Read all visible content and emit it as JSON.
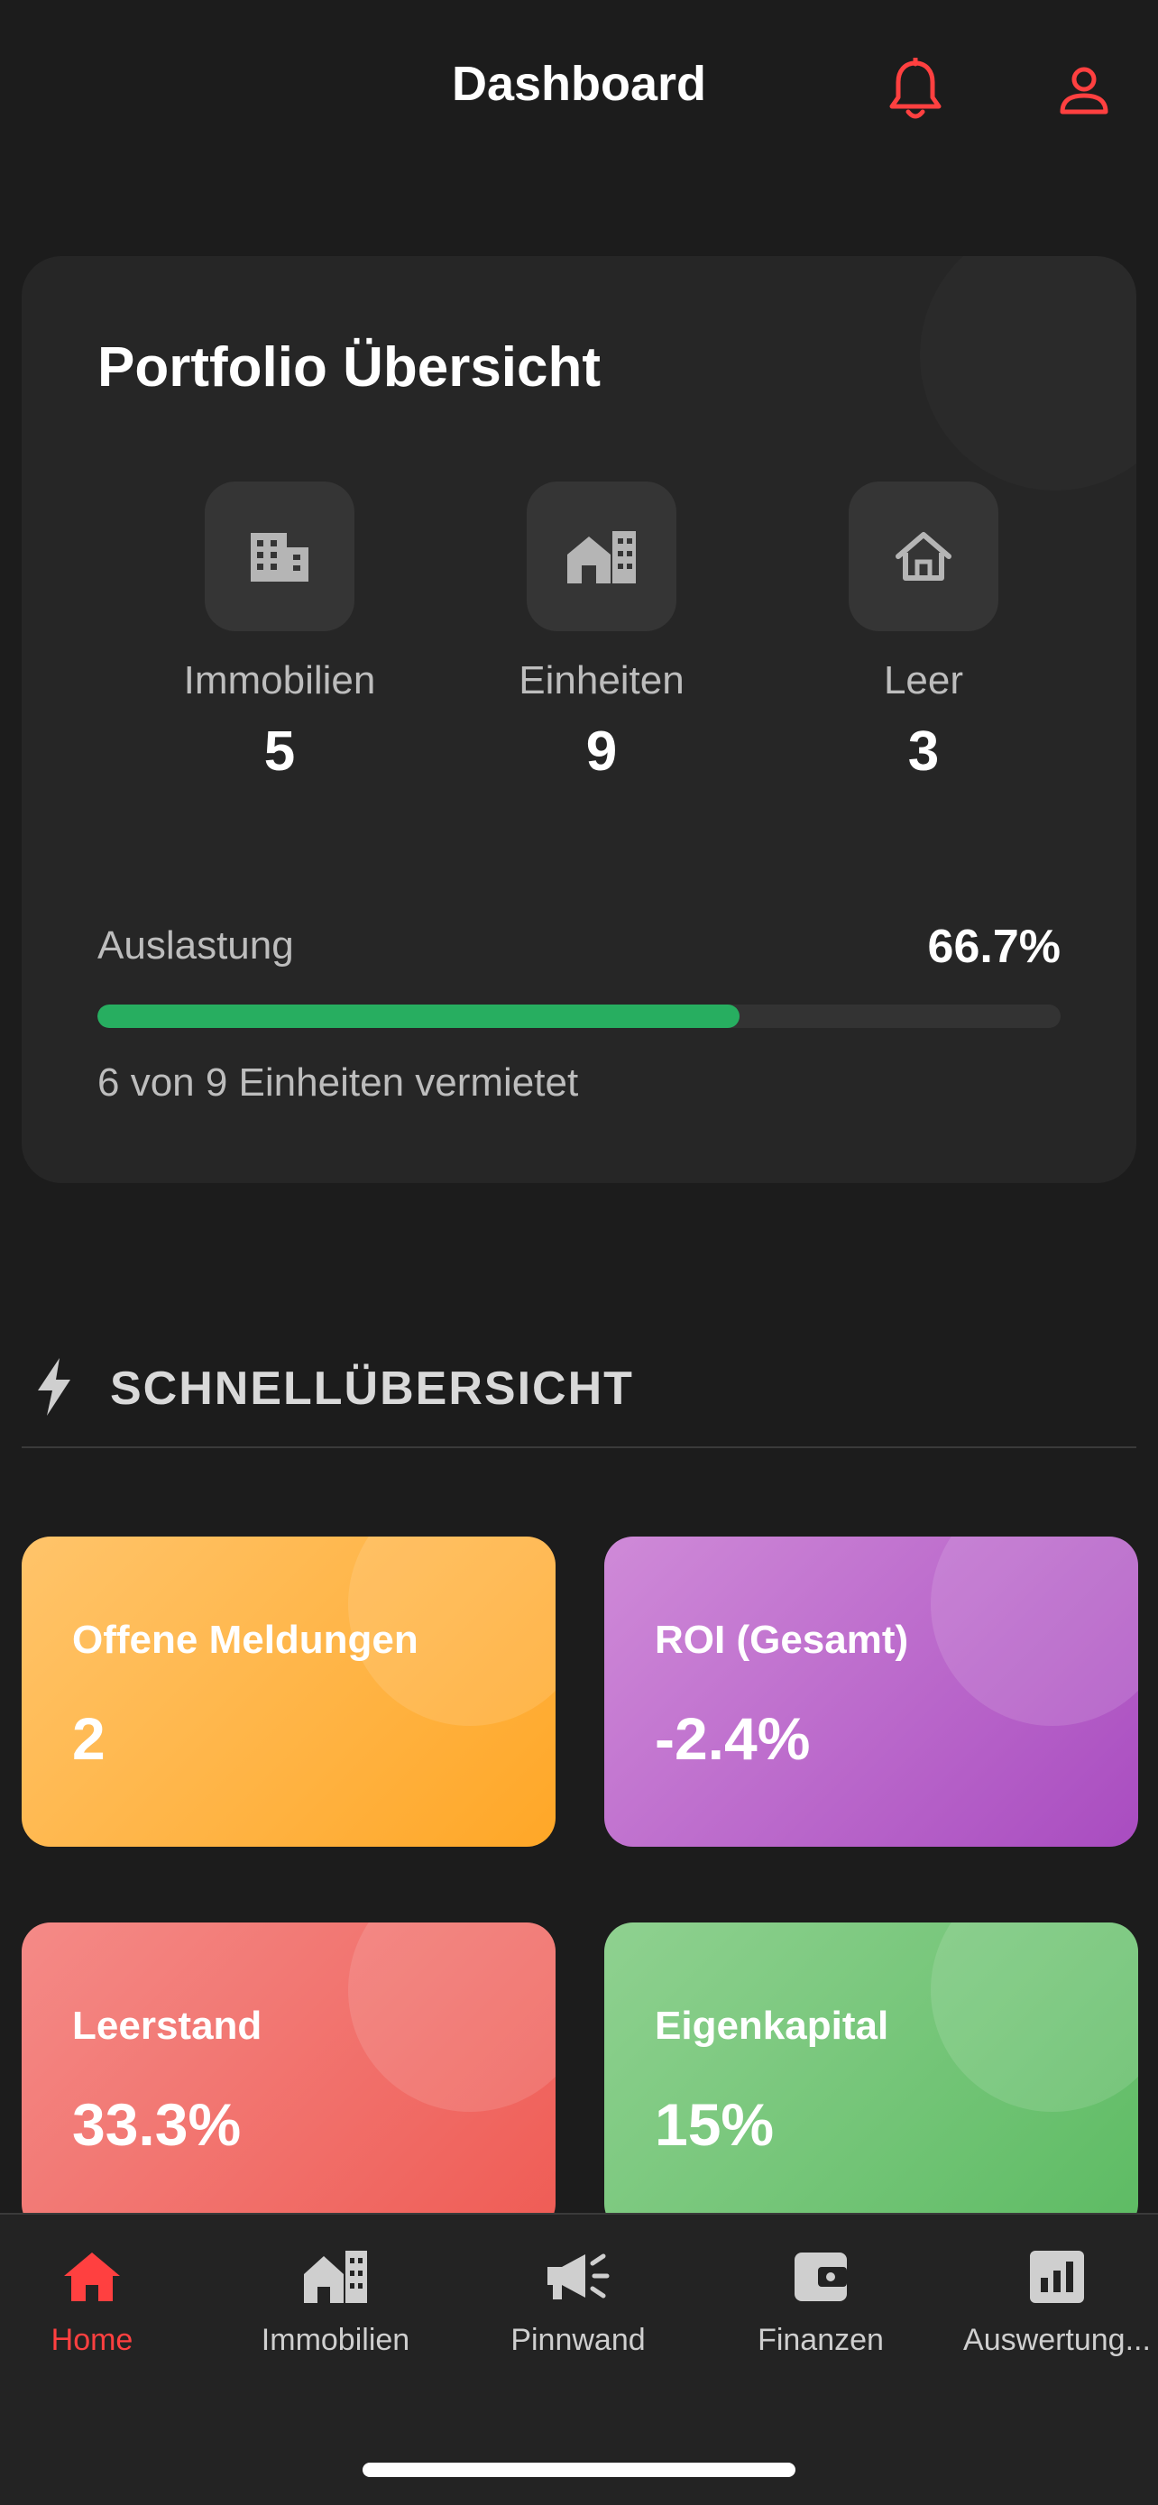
{
  "header": {
    "title": "Dashboard",
    "icons": [
      "bell-icon",
      "user-icon"
    ],
    "accent_color": "#ff4040"
  },
  "portfolio": {
    "title": "Portfolio Übersicht",
    "stats": [
      {
        "label": "Immobilien",
        "value": "5",
        "icon": "building-icon"
      },
      {
        "label": "Einheiten",
        "value": "9",
        "icon": "units-icon"
      },
      {
        "label": "Leer",
        "value": "3",
        "icon": "home-outline-icon"
      }
    ],
    "occupancy": {
      "label": "Auslastung",
      "value": "66.7%",
      "fraction": 0.667,
      "subtitle": "6 von 9 Einheiten vermietet",
      "bar_color": "#27ae60"
    }
  },
  "quick_overview": {
    "title": "SCHNELLÜBERSICHT",
    "icon": "lightning-icon",
    "cards": [
      {
        "label": "Offene Meldungen",
        "value": "2",
        "color": "#ffb547"
      },
      {
        "label": "ROI (Gesamt)",
        "value": "-2.4%",
        "color": "#bd6bcc"
      },
      {
        "label": "Leerstand",
        "value": "33.3%",
        "color": "#f27470"
      },
      {
        "label": "Eigenkapital",
        "value": "15%",
        "color": "#78c67a"
      }
    ]
  },
  "tabbar": {
    "active_index": 0,
    "tabs": [
      {
        "label": "Home",
        "icon": "home-icon"
      },
      {
        "label": "Immobilien",
        "icon": "building-icon"
      },
      {
        "label": "Pinnwand",
        "icon": "megaphone-icon"
      },
      {
        "label": "Finanzen",
        "icon": "wallet-icon"
      },
      {
        "label": "Auswertung...",
        "icon": "analytics-icon"
      }
    ]
  }
}
